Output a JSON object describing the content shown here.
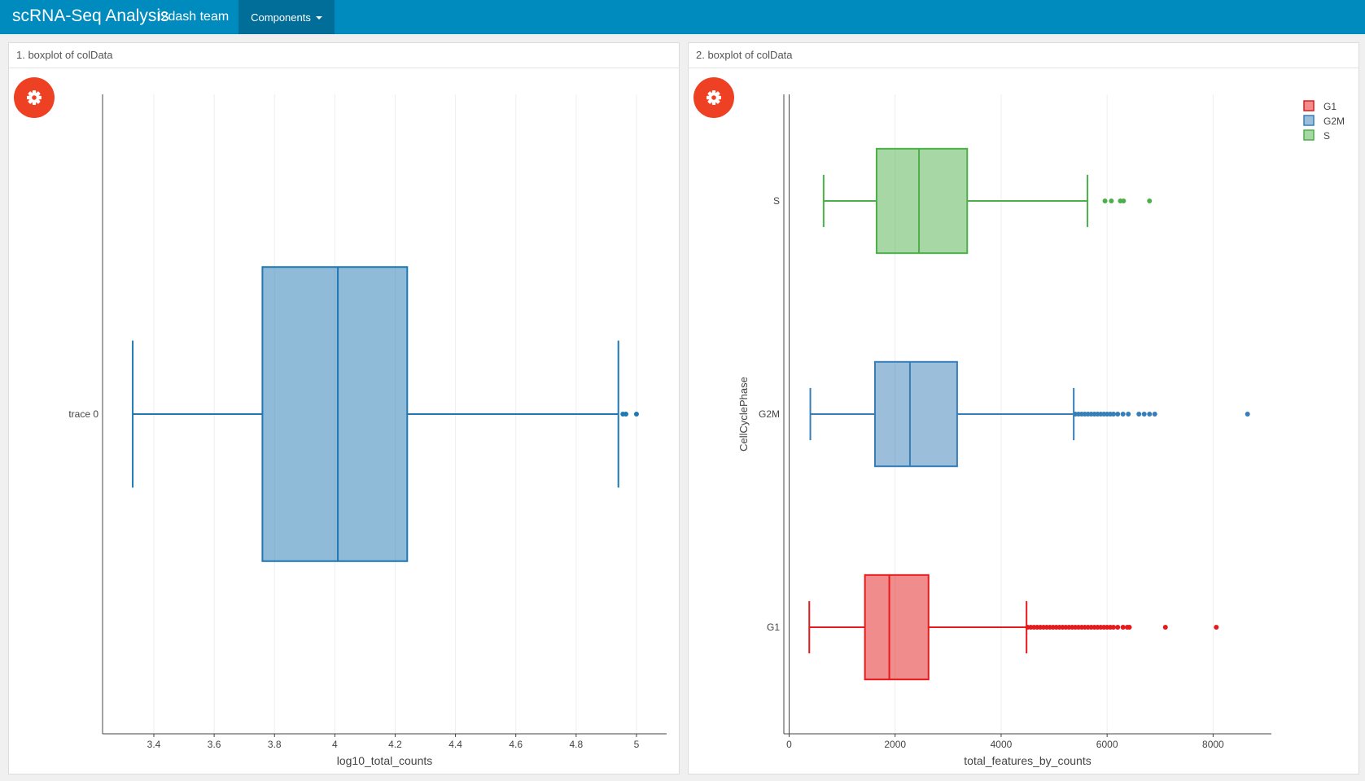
{
  "navbar": {
    "title": "scRNA-Seq Analysis",
    "subtitle": "i2dash team",
    "menu_label": "Components"
  },
  "colors": {
    "navbar": "#008bbf",
    "navbar_active": "#006e98",
    "gear_button": "#ee4123"
  },
  "panels": [
    {
      "title": "1. boxplot of colData",
      "settings_icon": "gear-icon",
      "chart_data": {
        "type": "box",
        "orientation": "horizontal",
        "title": "",
        "xlabel": "log10_total_counts",
        "ylabel": "",
        "xlim": [
          3.23,
          5.1
        ],
        "xticks": [
          3.4,
          3.6,
          3.8,
          4,
          4.2,
          4.4,
          4.6,
          4.8,
          5
        ],
        "grid": true,
        "legend": "none",
        "series": [
          {
            "name": "trace 0",
            "color": "#1f77b4",
            "min": 3.33,
            "q1": 3.76,
            "median": 4.01,
            "q3": 4.24,
            "max": 4.94,
            "outliers": [
              4.955,
              4.965,
              5.0
            ]
          }
        ]
      }
    },
    {
      "title": "2. boxplot of colData",
      "settings_icon": "gear-icon",
      "chart_data": {
        "type": "box",
        "orientation": "horizontal",
        "title": "",
        "xlabel": "total_features_by_counts",
        "ylabel": "CellCyclePhase",
        "xlim": [
          -100,
          9100
        ],
        "xticks": [
          0,
          2000,
          4000,
          6000,
          8000
        ],
        "grid": true,
        "legend": "top-right",
        "series": [
          {
            "name": "G1",
            "color": "#e41a1c",
            "min": 380,
            "q1": 1430,
            "median": 1890,
            "q3": 2630,
            "max": 4480,
            "outliers": [
              4500,
              4560,
              4620,
              4680,
              4740,
              4800,
              4860,
              4920,
              4980,
              5040,
              5100,
              5160,
              5220,
              5280,
              5340,
              5400,
              5460,
              5520,
              5580,
              5640,
              5700,
              5760,
              5820,
              5880,
              5940,
              6000,
              6060,
              6120,
              6200,
              6300,
              6380,
              6420,
              7100,
              8060
            ]
          },
          {
            "name": "G2M",
            "color": "#377eb8",
            "min": 400,
            "q1": 1620,
            "median": 2280,
            "q3": 3170,
            "max": 5370,
            "outliers": [
              5400,
              5460,
              5520,
              5580,
              5640,
              5700,
              5760,
              5820,
              5880,
              5940,
              6000,
              6060,
              6120,
              6200,
              6300,
              6400,
              6600,
              6700,
              6800,
              6900,
              8650
            ]
          },
          {
            "name": "S",
            "color": "#4daf4a",
            "min": 650,
            "q1": 1650,
            "median": 2450,
            "q3": 3360,
            "max": 5630,
            "outliers": [
              5960,
              6080,
              6250,
              6310,
              6800
            ]
          }
        ]
      }
    }
  ]
}
